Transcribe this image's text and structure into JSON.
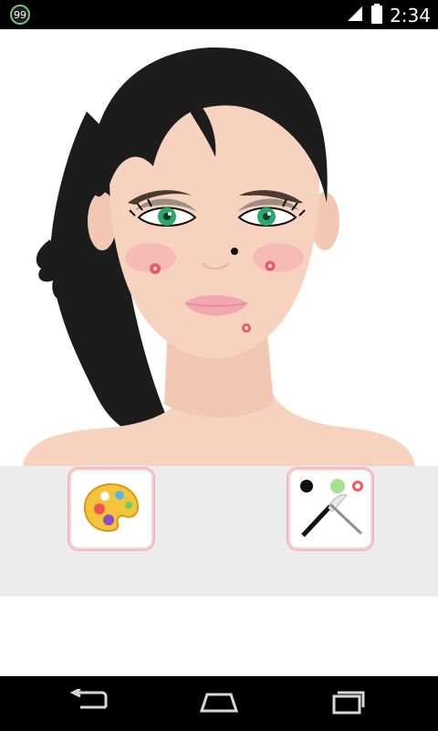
{
  "status_bar": {
    "notification_badge": "99",
    "time": "2:34",
    "icons": [
      "notification-99-icon",
      "signal-icon",
      "battery-icon"
    ]
  },
  "stage": {
    "subject": "makeup-face-illustration"
  },
  "tools": [
    {
      "name": "palette-button",
      "icon": "paint-palette-icon"
    },
    {
      "name": "brush-button",
      "icon": "makeup-brush-icon"
    }
  ],
  "nav_bar": {
    "buttons": [
      "back-icon",
      "home-icon",
      "recent-apps-icon"
    ]
  },
  "colors": {
    "skin": "#f7d3bf",
    "hair": "#1c1c1c",
    "eyes": "#2aa86a",
    "lips": "#f2a6b0",
    "pimple": "#e55b6d",
    "panel": "#ececec",
    "button_border": "#f1b9bf"
  }
}
